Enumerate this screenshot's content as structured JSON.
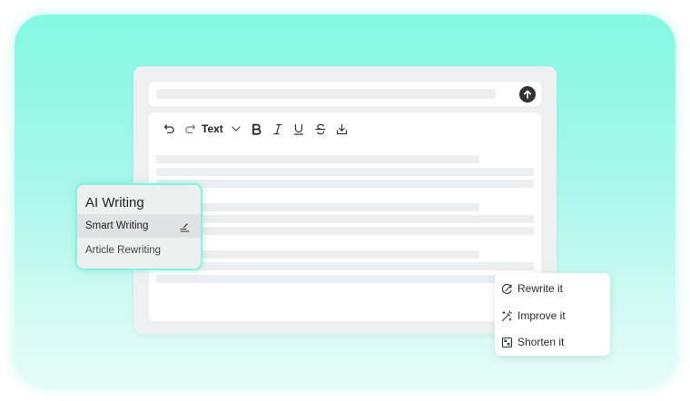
{
  "toolbar": {
    "format_label": "Text"
  },
  "ai_panel": {
    "title": "AI Writing",
    "items": [
      {
        "label": "Smart Writing",
        "selected": true
      },
      {
        "label": "Article Rewriting"
      }
    ]
  },
  "context_menu": {
    "items": [
      {
        "label": "Rewrite it",
        "icon": "rewrite-icon"
      },
      {
        "label": "Improve it",
        "icon": "magic-wand-icon"
      },
      {
        "label": "Shorten it",
        "icon": "shorten-icon"
      }
    ]
  },
  "colors": {
    "accent": "#86f2dd",
    "background_top": "#84f9e3",
    "background_bottom": "#e6fcf8"
  }
}
